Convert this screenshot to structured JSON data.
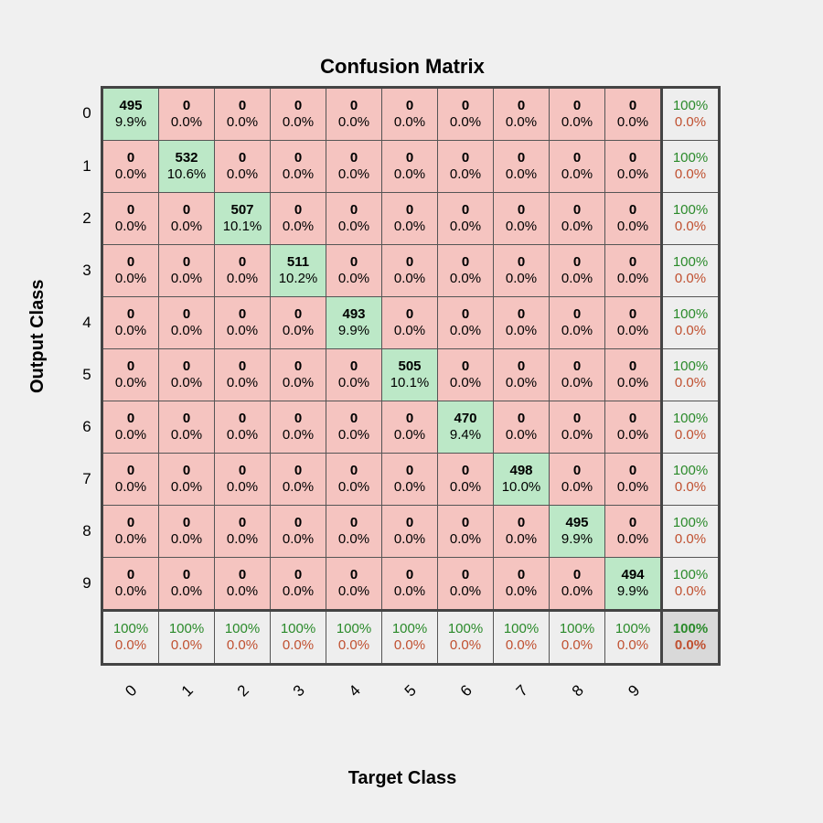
{
  "title": "Confusion Matrix",
  "ylabel": "Output Class",
  "xlabel": "Target Class",
  "classes": [
    "0",
    "1",
    "2",
    "3",
    "4",
    "5",
    "6",
    "7",
    "8",
    "9"
  ],
  "counts": [
    [
      495,
      0,
      0,
      0,
      0,
      0,
      0,
      0,
      0,
      0
    ],
    [
      0,
      532,
      0,
      0,
      0,
      0,
      0,
      0,
      0,
      0
    ],
    [
      0,
      0,
      507,
      0,
      0,
      0,
      0,
      0,
      0,
      0
    ],
    [
      0,
      0,
      0,
      511,
      0,
      0,
      0,
      0,
      0,
      0
    ],
    [
      0,
      0,
      0,
      0,
      493,
      0,
      0,
      0,
      0,
      0
    ],
    [
      0,
      0,
      0,
      0,
      0,
      505,
      0,
      0,
      0,
      0
    ],
    [
      0,
      0,
      0,
      0,
      0,
      0,
      470,
      0,
      0,
      0
    ],
    [
      0,
      0,
      0,
      0,
      0,
      0,
      0,
      498,
      0,
      0
    ],
    [
      0,
      0,
      0,
      0,
      0,
      0,
      0,
      0,
      495,
      0
    ],
    [
      0,
      0,
      0,
      0,
      0,
      0,
      0,
      0,
      0,
      494
    ]
  ],
  "pct": [
    [
      "9.9%",
      "0.0%",
      "0.0%",
      "0.0%",
      "0.0%",
      "0.0%",
      "0.0%",
      "0.0%",
      "0.0%",
      "0.0%"
    ],
    [
      "0.0%",
      "10.6%",
      "0.0%",
      "0.0%",
      "0.0%",
      "0.0%",
      "0.0%",
      "0.0%",
      "0.0%",
      "0.0%"
    ],
    [
      "0.0%",
      "0.0%",
      "10.1%",
      "0.0%",
      "0.0%",
      "0.0%",
      "0.0%",
      "0.0%",
      "0.0%",
      "0.0%"
    ],
    [
      "0.0%",
      "0.0%",
      "0.0%",
      "10.2%",
      "0.0%",
      "0.0%",
      "0.0%",
      "0.0%",
      "0.0%",
      "0.0%"
    ],
    [
      "0.0%",
      "0.0%",
      "0.0%",
      "0.0%",
      "9.9%",
      "0.0%",
      "0.0%",
      "0.0%",
      "0.0%",
      "0.0%"
    ],
    [
      "0.0%",
      "0.0%",
      "0.0%",
      "0.0%",
      "0.0%",
      "10.1%",
      "0.0%",
      "0.0%",
      "0.0%",
      "0.0%"
    ],
    [
      "0.0%",
      "0.0%",
      "0.0%",
      "0.0%",
      "0.0%",
      "0.0%",
      "9.4%",
      "0.0%",
      "0.0%",
      "0.0%"
    ],
    [
      "0.0%",
      "0.0%",
      "0.0%",
      "0.0%",
      "0.0%",
      "0.0%",
      "0.0%",
      "10.0%",
      "0.0%",
      "0.0%"
    ],
    [
      "0.0%",
      "0.0%",
      "0.0%",
      "0.0%",
      "0.0%",
      "0.0%",
      "0.0%",
      "0.0%",
      "9.9%",
      "0.0%"
    ],
    [
      "0.0%",
      "0.0%",
      "0.0%",
      "0.0%",
      "0.0%",
      "0.0%",
      "0.0%",
      "0.0%",
      "0.0%",
      "9.9%"
    ]
  ],
  "row_sum": [
    {
      "top": "100%",
      "bot": "0.0%"
    },
    {
      "top": "100%",
      "bot": "0.0%"
    },
    {
      "top": "100%",
      "bot": "0.0%"
    },
    {
      "top": "100%",
      "bot": "0.0%"
    },
    {
      "top": "100%",
      "bot": "0.0%"
    },
    {
      "top": "100%",
      "bot": "0.0%"
    },
    {
      "top": "100%",
      "bot": "0.0%"
    },
    {
      "top": "100%",
      "bot": "0.0%"
    },
    {
      "top": "100%",
      "bot": "0.0%"
    },
    {
      "top": "100%",
      "bot": "0.0%"
    }
  ],
  "col_sum": [
    {
      "top": "100%",
      "bot": "0.0%"
    },
    {
      "top": "100%",
      "bot": "0.0%"
    },
    {
      "top": "100%",
      "bot": "0.0%"
    },
    {
      "top": "100%",
      "bot": "0.0%"
    },
    {
      "top": "100%",
      "bot": "0.0%"
    },
    {
      "top": "100%",
      "bot": "0.0%"
    },
    {
      "top": "100%",
      "bot": "0.0%"
    },
    {
      "top": "100%",
      "bot": "0.0%"
    },
    {
      "top": "100%",
      "bot": "0.0%"
    },
    {
      "top": "100%",
      "bot": "0.0%"
    }
  ],
  "total": {
    "top": "100%",
    "bot": "0.0%"
  },
  "chart_data": {
    "type": "heatmap",
    "title": "Confusion Matrix",
    "xlabel": "Target Class",
    "ylabel": "Output Class",
    "categories": [
      "0",
      "1",
      "2",
      "3",
      "4",
      "5",
      "6",
      "7",
      "8",
      "9"
    ],
    "matrix_counts": [
      [
        495,
        0,
        0,
        0,
        0,
        0,
        0,
        0,
        0,
        0
      ],
      [
        0,
        532,
        0,
        0,
        0,
        0,
        0,
        0,
        0,
        0
      ],
      [
        0,
        0,
        507,
        0,
        0,
        0,
        0,
        0,
        0,
        0
      ],
      [
        0,
        0,
        0,
        511,
        0,
        0,
        0,
        0,
        0,
        0
      ],
      [
        0,
        0,
        0,
        0,
        493,
        0,
        0,
        0,
        0,
        0
      ],
      [
        0,
        0,
        0,
        0,
        0,
        505,
        0,
        0,
        0,
        0
      ],
      [
        0,
        0,
        0,
        0,
        0,
        0,
        470,
        0,
        0,
        0
      ],
      [
        0,
        0,
        0,
        0,
        0,
        0,
        0,
        498,
        0,
        0
      ],
      [
        0,
        0,
        0,
        0,
        0,
        0,
        0,
        0,
        495,
        0
      ],
      [
        0,
        0,
        0,
        0,
        0,
        0,
        0,
        0,
        0,
        494
      ]
    ],
    "matrix_pct_of_total": [
      [
        9.9,
        0,
        0,
        0,
        0,
        0,
        0,
        0,
        0,
        0
      ],
      [
        0,
        10.6,
        0,
        0,
        0,
        0,
        0,
        0,
        0,
        0
      ],
      [
        0,
        0,
        10.1,
        0,
        0,
        0,
        0,
        0,
        0,
        0
      ],
      [
        0,
        0,
        0,
        10.2,
        0,
        0,
        0,
        0,
        0,
        0
      ],
      [
        0,
        0,
        0,
        0,
        9.9,
        0,
        0,
        0,
        0,
        0
      ],
      [
        0,
        0,
        0,
        0,
        0,
        10.1,
        0,
        0,
        0,
        0
      ],
      [
        0,
        0,
        0,
        0,
        0,
        0,
        9.4,
        0,
        0,
        0
      ],
      [
        0,
        0,
        0,
        0,
        0,
        0,
        0,
        10.0,
        0,
        0
      ],
      [
        0,
        0,
        0,
        0,
        0,
        0,
        0,
        0,
        9.9,
        0
      ],
      [
        0,
        0,
        0,
        0,
        0,
        0,
        0,
        0,
        0,
        9.9
      ]
    ],
    "row_precision_pct": [
      100,
      100,
      100,
      100,
      100,
      100,
      100,
      100,
      100,
      100
    ],
    "row_error_pct": [
      0,
      0,
      0,
      0,
      0,
      0,
      0,
      0,
      0,
      0
    ],
    "col_recall_pct": [
      100,
      100,
      100,
      100,
      100,
      100,
      100,
      100,
      100,
      100
    ],
    "col_error_pct": [
      0,
      0,
      0,
      0,
      0,
      0,
      0,
      0,
      0,
      0
    ],
    "overall_accuracy_pct": 100,
    "overall_error_pct": 0
  }
}
